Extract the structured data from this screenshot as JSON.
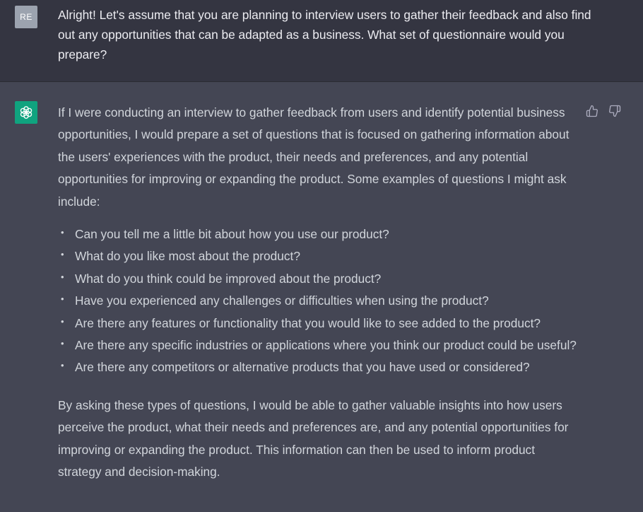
{
  "user_message": {
    "avatar_initials": "RE",
    "text": "Alright! Let's assume that you are planning to interview users to gather their feedback and also find out any opportunities that can be adapted as a business. What set of questionnaire would you prepare?"
  },
  "assistant_message": {
    "avatar_icon": "openai-logo-icon",
    "intro": "If I were conducting an interview to gather feedback from users and identify potential business opportunities, I would prepare a set of questions that is focused on gathering information about the users' experiences with the product, their needs and preferences, and any potential opportunities for improving or expanding the product. Some examples of questions I might ask include:",
    "questions": [
      "Can you tell me a little bit about how you use our product?",
      "What do you like most about the product?",
      "What do you think could be improved about the product?",
      "Have you experienced any challenges or difficulties when using the product?",
      "Are there any features or functionality that you would like to see added to the product?",
      "Are there any specific industries or applications where you think our product could be useful?",
      "Are there any competitors or alternative products that you have used or considered?"
    ],
    "conclusion": "By asking these types of questions, I would be able to gather valuable insights into how users perceive the product, what their needs and preferences are, and any potential opportunities for improving or expanding the product. This information can then be used to inform product strategy and decision-making."
  },
  "feedback": {
    "thumbs_up_icon": "thumbs-up-icon",
    "thumbs_down_icon": "thumbs-down-icon"
  },
  "colors": {
    "user_bg": "#343541",
    "assistant_bg": "#444654",
    "assistant_avatar": "#10a37f",
    "user_avatar": "#9ca3af",
    "text": "#d1d5db"
  }
}
